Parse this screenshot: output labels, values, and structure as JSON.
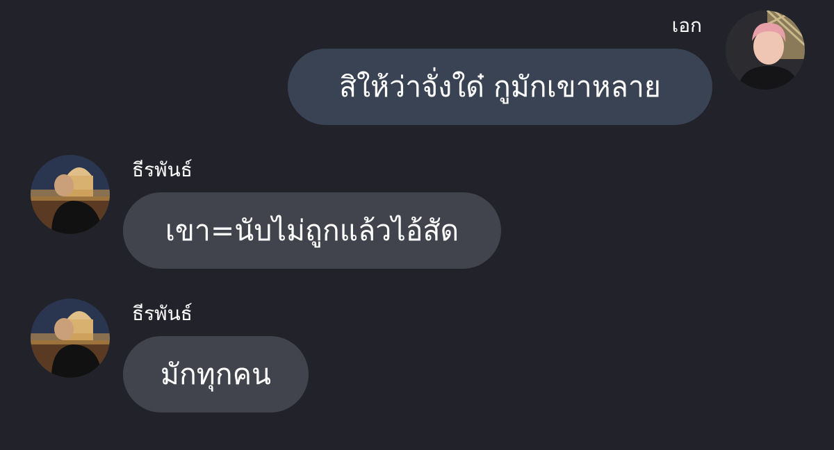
{
  "colors": {
    "background": "#22232a",
    "outgoing_bubble": "#3a4354",
    "incoming_bubble": "#42444d",
    "text": "#ffffff"
  },
  "messages": [
    {
      "sender": "เอก",
      "text": "สิให้ว่าจั่งใด๋ กูมักเขาหลาย",
      "direction": "outgoing"
    },
    {
      "sender": "ธีรพันธ์",
      "text": "เขา=นับไม่ถูกแล้วไอ้สัด",
      "direction": "incoming"
    },
    {
      "sender": "ธีรพันธ์",
      "text": "มักทุกคน",
      "direction": "incoming"
    }
  ]
}
